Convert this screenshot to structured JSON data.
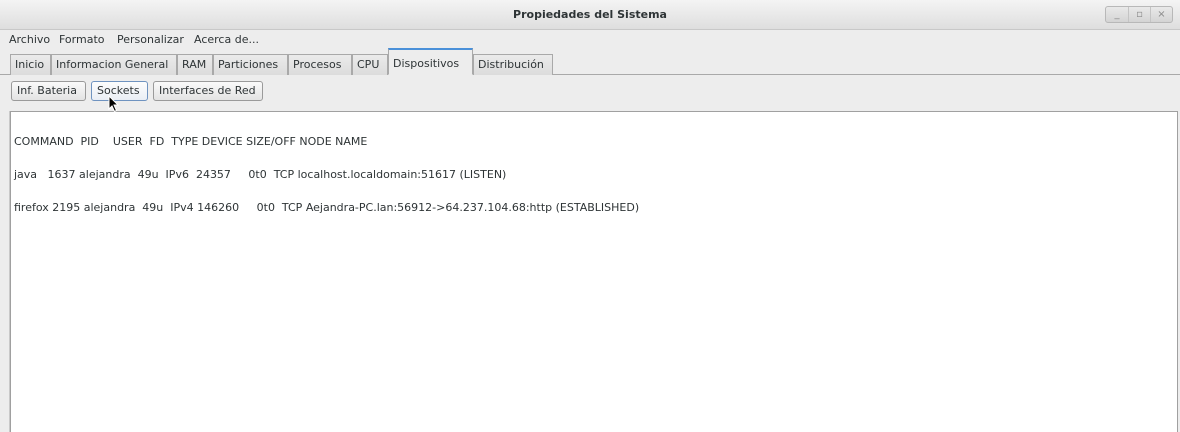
{
  "window": {
    "title": "Propiedades del Sistema",
    "controls": [
      "_",
      "▫",
      "×"
    ]
  },
  "menubar": {
    "items": [
      "Archivo",
      "Formato",
      "Personalizar",
      "Acerca de..."
    ]
  },
  "tabs": [
    {
      "label": "Inicio",
      "active": false
    },
    {
      "label": "Informacion General",
      "active": false
    },
    {
      "label": "RAM",
      "active": false
    },
    {
      "label": "Particiones",
      "active": false
    },
    {
      "label": "Procesos",
      "active": false
    },
    {
      "label": "CPU",
      "active": false
    },
    {
      "label": "Dispositivos",
      "active": true
    },
    {
      "label": "Distribución",
      "active": false
    }
  ],
  "subtoolbar": {
    "buttons": [
      "Inf. Bateria",
      "Sockets",
      "Interfaces de Red"
    ],
    "hovered": "Sockets"
  },
  "output": {
    "lines": [
      "COMMAND  PID    USER  FD  TYPE DEVICE SIZE/OFF NODE NAME",
      "java   1637 alejandra  49u  IPv6  24357     0t0  TCP localhost.localdomain:51617 (LISTEN)",
      "firefox 2195 alejandra  49u  IPv4 146260     0t0  TCP Aejandra-PC.lan:56912->64.237.104.68:http (ESTABLISHED)"
    ]
  },
  "colors": {
    "active_tab_accent": "#4a90d9",
    "window_bg": "#ededed",
    "text_area_bg": "#ffffff"
  }
}
